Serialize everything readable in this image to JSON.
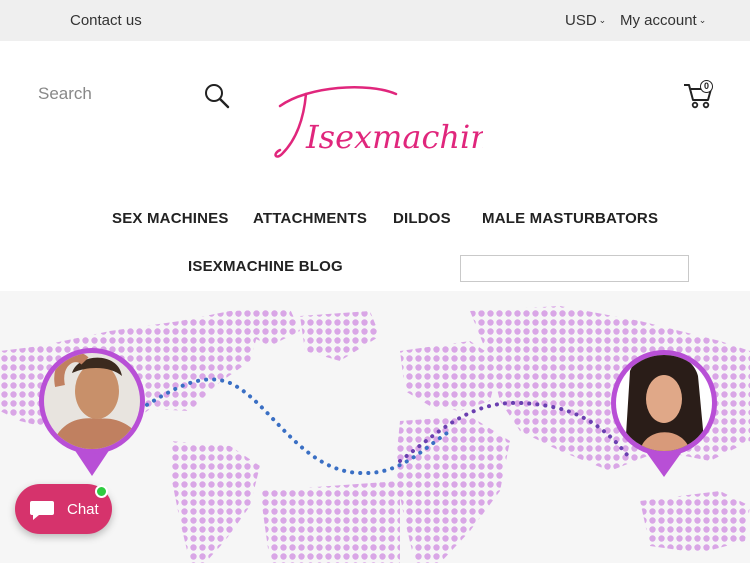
{
  "topbar": {
    "contact": "Contact us",
    "currency": "USD",
    "account": "My account"
  },
  "header": {
    "search_placeholder": "Search",
    "logo_text": "Isexmachine",
    "cart_count": "0"
  },
  "nav": {
    "items": [
      "SEX MACHINES",
      "ATTACHMENTS",
      "DILDOS",
      "MALE MASTURBATORS",
      "ISEXMACHINE BLOG"
    ]
  },
  "chat": {
    "label": "Chat"
  },
  "colors": {
    "brand_pink": "#e0267c",
    "chat_button": "#d6336c",
    "map_dots": "#d9a6e6",
    "pin_purple": "#b84fd6",
    "topbar_bg": "#efefef"
  }
}
